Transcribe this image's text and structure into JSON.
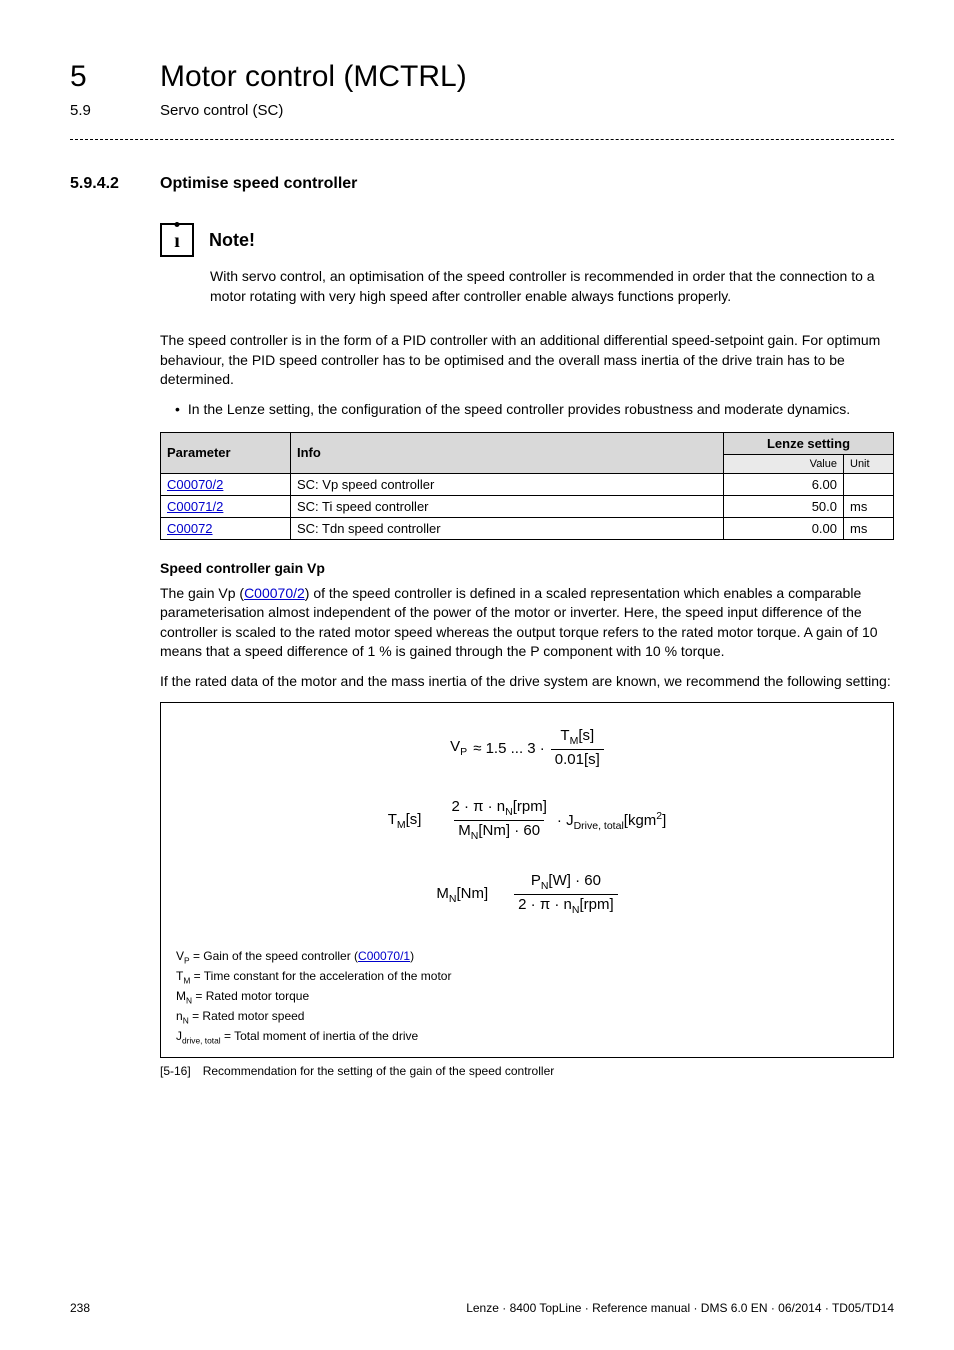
{
  "header": {
    "chapter_num": "5",
    "chapter_title": "Motor control (MCTRL)",
    "sub_num": "5.9",
    "sub_title": "Servo control (SC)"
  },
  "section": {
    "num": "5.9.4.2",
    "title": "Optimise speed controller"
  },
  "note": {
    "label": "Note!",
    "text": "With servo control, an optimisation of the speed controller is recommended in order that the connection to a motor rotating with very high speed after controller enable always functions properly."
  },
  "body": {
    "para1": "The speed controller is in the form of a PID controller with an additional differential speed-setpoint gain. For optimum behaviour, the PID speed controller has to be optimised and the overall mass inertia of the drive train has to be determined.",
    "bullet1": "In the Lenze setting, the configuration of the speed controller provides robustness and moderate dynamics."
  },
  "table": {
    "head_param": "Parameter",
    "head_info": "Info",
    "head_lenze": "Lenze setting",
    "sub_value": "Value",
    "sub_unit": "Unit",
    "rows": [
      {
        "param": "C00070/2",
        "info": "SC: Vp speed controller",
        "value": "6.00",
        "unit": ""
      },
      {
        "param": "C00071/2",
        "info": "SC: Ti speed controller",
        "value": "50.0",
        "unit": "ms"
      },
      {
        "param": "C00072",
        "info": "SC: Tdn speed controller",
        "value": "0.00",
        "unit": "ms"
      }
    ]
  },
  "vp_section": {
    "title": "Speed controller gain Vp",
    "para1_a": "The gain Vp (",
    "para1_link": "C00070/2",
    "para1_b": ") of the speed controller is defined in a scaled representation which enables a comparable parameterisation almost independent of the power of the motor or inverter. Here, the speed input difference of the controller is scaled to the rated motor speed whereas the output torque refers to the rated motor torque. A gain of 10 means that a speed difference of 1 % is gained through the P component with 10 % torque.",
    "para2": "If the rated data of the motor and the mass inertia of the drive system are known, we recommend the following setting:"
  },
  "formulas": {
    "f1_lhs": "V",
    "f1_lhs_sub": "P",
    "f1_approx": "≈ 1.5 ... 3 ·",
    "f1_num_a": "T",
    "f1_num_sub": "M",
    "f1_num_unit": "[s]",
    "f1_den": "0.01[s]",
    "f2_lhs_a": "T",
    "f2_lhs_sub": "M",
    "f2_lhs_unit": "[s]",
    "f2_num": "2 · π · n",
    "f2_num_sub": "N",
    "f2_num_unit": "[rpm]",
    "f2_den_a": "M",
    "f2_den_sub": "N",
    "f2_den_unit": "[Nm] · 60",
    "f2_tail_a": " · J",
    "f2_tail_sub": "Drive, total",
    "f2_tail_unit": "[kgm",
    "f2_tail_sup": "2",
    "f2_tail_close": "]",
    "f3_lhs_a": "M",
    "f3_lhs_sub": "N",
    "f3_lhs_unit": "[Nm]",
    "f3_num_a": "P",
    "f3_num_sub": "N",
    "f3_num_unit": "[W] · 60",
    "f3_den": "2 · π · n",
    "f3_den_sub": "N",
    "f3_den_unit": "[rpm]"
  },
  "defs": {
    "d1_a": "V",
    "d1_sub": "P",
    "d1_b": " = Gain of the speed controller (",
    "d1_link": "C00070/1",
    "d1_c": ")",
    "d2_a": "T",
    "d2_sub": "M",
    "d2_b": " = Time constant for the acceleration of the motor",
    "d3_a": "M",
    "d3_sub": "N",
    "d3_b": " = Rated motor torque",
    "d4_a": "n",
    "d4_sub": "N",
    "d4_b": " = Rated motor speed",
    "d5_a": "J",
    "d5_sub": "drive, total",
    "d5_b": " = Total moment of inertia of the drive"
  },
  "caption": {
    "tag": "[5-16]",
    "text": "Recommendation for the setting of the gain of the speed controller"
  },
  "footer": {
    "page": "238",
    "right": "Lenze · 8400 TopLine · Reference manual · DMS 6.0 EN · 06/2014 · TD05/TD14"
  }
}
